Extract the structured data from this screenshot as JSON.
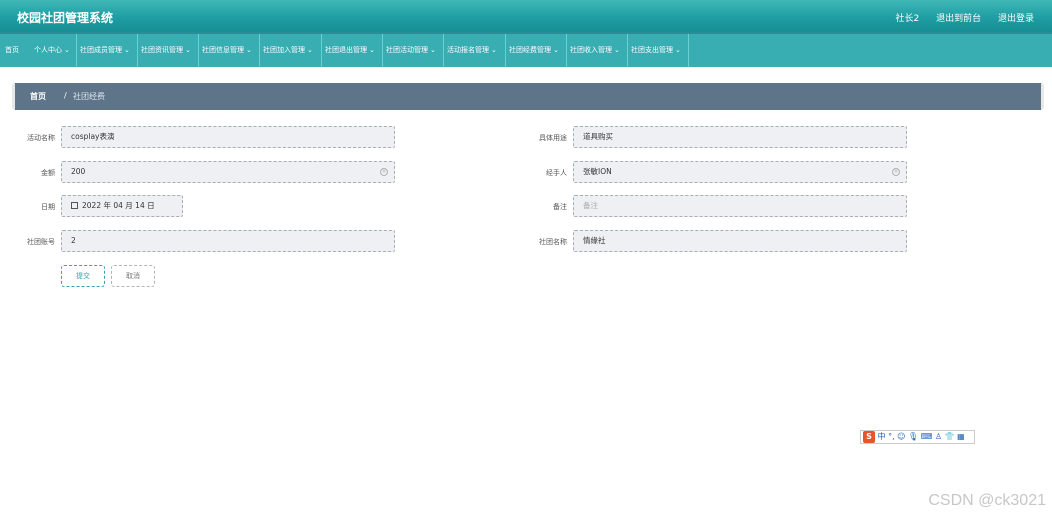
{
  "header": {
    "title": "校园社团管理系统",
    "user": "社长2",
    "back_to_admin": "退出到前台",
    "logout": "退出登录"
  },
  "nav": {
    "items": [
      {
        "label": "首页",
        "has_dropdown": false
      },
      {
        "label": "个人中心",
        "has_dropdown": true
      },
      {
        "label": "社团成员管理",
        "has_dropdown": true
      },
      {
        "label": "社团资讯管理",
        "has_dropdown": true
      },
      {
        "label": "社团信息管理",
        "has_dropdown": true
      },
      {
        "label": "社团加入管理",
        "has_dropdown": true
      },
      {
        "label": "社团退出管理",
        "has_dropdown": true
      },
      {
        "label": "社团活动管理",
        "has_dropdown": true
      },
      {
        "label": "活动报名管理",
        "has_dropdown": true
      },
      {
        "label": "社团经费管理",
        "has_dropdown": true
      },
      {
        "label": "社团收入管理",
        "has_dropdown": true
      },
      {
        "label": "社团支出管理",
        "has_dropdown": true
      }
    ],
    "chevron": "⌄"
  },
  "breadcrumb": {
    "home": "首页",
    "separator": "/",
    "current": "社团经费"
  },
  "form": {
    "activity_name": {
      "label": "活动名称",
      "value": "cosplay表演"
    },
    "amount": {
      "label": "金额",
      "value": "200"
    },
    "date": {
      "label": "日期",
      "value": "2022 年 04 月 14 日"
    },
    "club_account": {
      "label": "社团账号",
      "value": "2"
    },
    "purpose": {
      "label": "具体用途",
      "value": "道具购买"
    },
    "handler": {
      "label": "经手人",
      "value": "张敏ION"
    },
    "remark": {
      "label": "备注",
      "value": "",
      "placeholder": "备注"
    },
    "club_name": {
      "label": "社团名称",
      "value": "情缘社"
    }
  },
  "buttons": {
    "submit": "提交",
    "cancel": "取消"
  },
  "ime_toolbar": {
    "logo": "S",
    "text": "中 °, ☺ 🎙 ⌨ ♙ 👕 ▦"
  },
  "watermark": "CSDN @ck3021",
  "colors": {
    "topbar": "#1e9ea3",
    "navbar": "#38adb2",
    "breadcrumb_bg": "#5e7489",
    "submit_accent": "#3a9fb0"
  }
}
